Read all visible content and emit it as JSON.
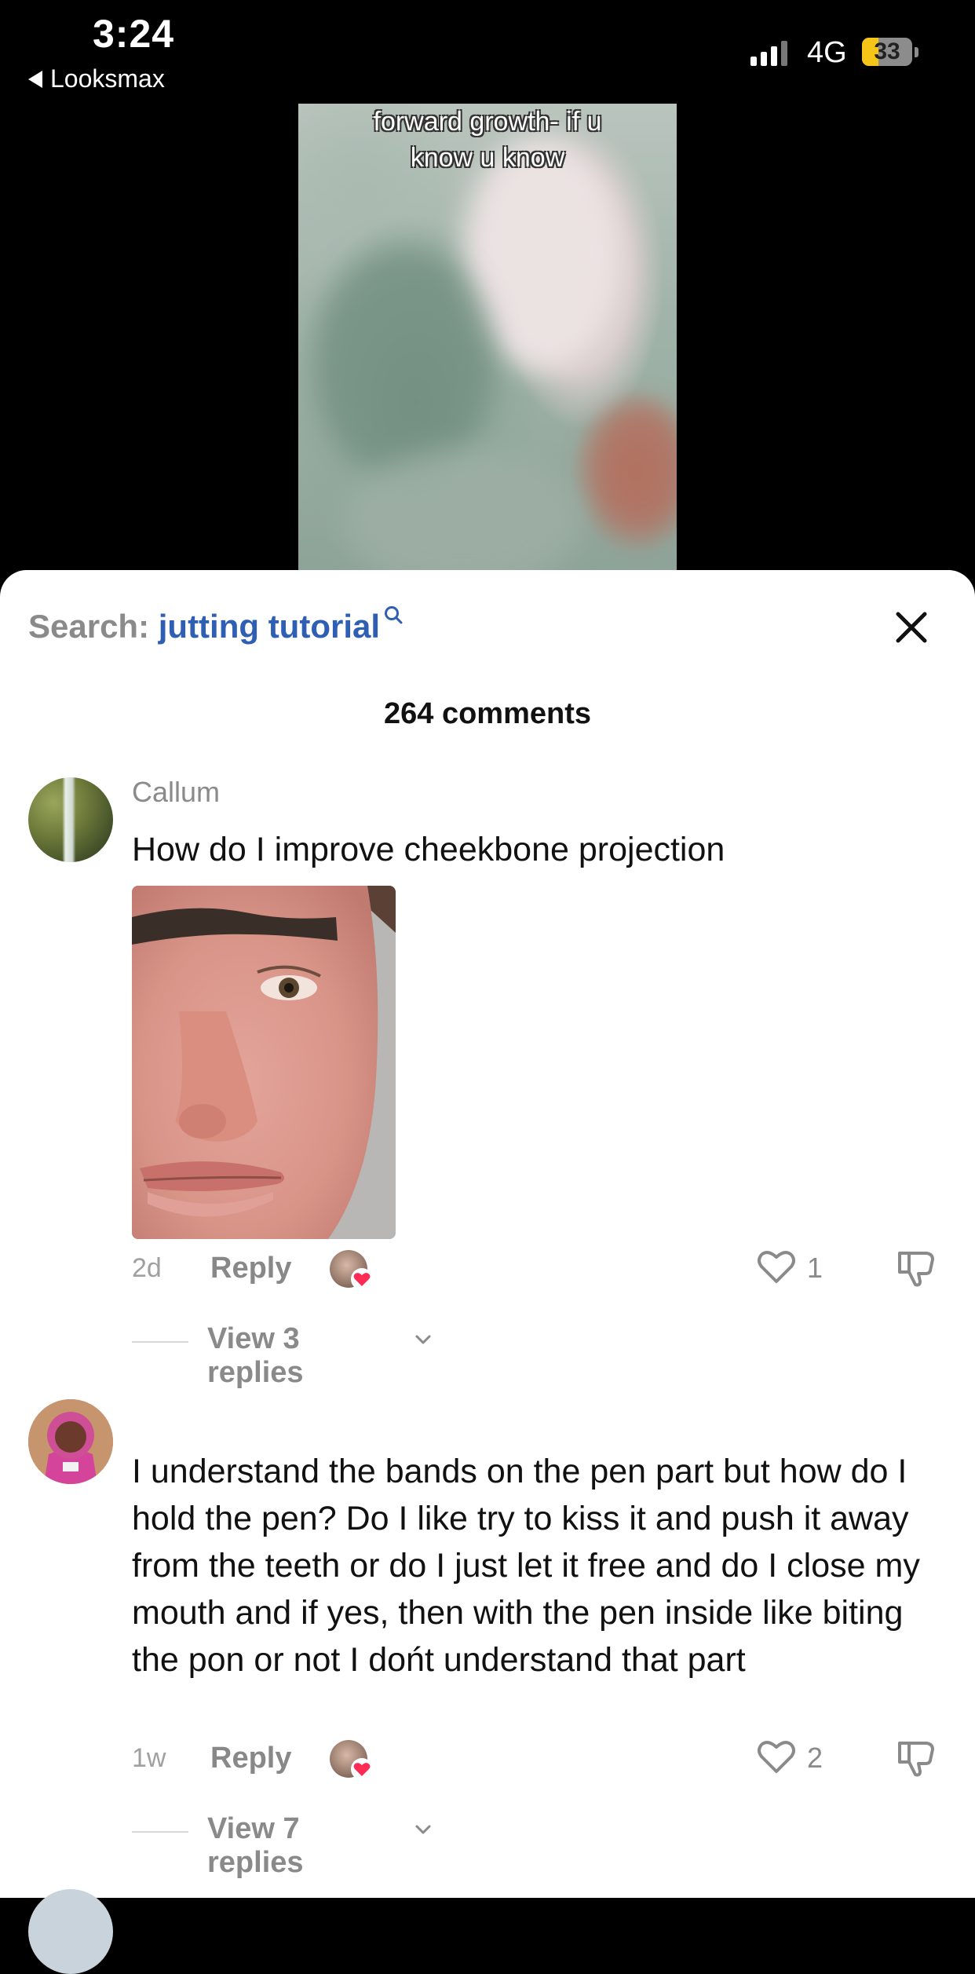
{
  "status_bar": {
    "time": "3:24",
    "back_label": "Looksmax",
    "network": "4G",
    "battery": "33",
    "battery_level": 0.33
  },
  "video": {
    "caption_line1": "forward growth- if u",
    "caption_line2": "know u know"
  },
  "sheet": {
    "search_label": "Search:",
    "search_term": "jutting tutorial",
    "comment_count": "264 comments"
  },
  "comments": [
    {
      "username": "Callum",
      "text": "How do I improve cheekbone projection",
      "time": "2d",
      "reply_label": "Reply",
      "likes": "1",
      "view_replies": "View 3 replies"
    },
    {
      "username": "",
      "text": "I understand the bands on the pen part but how do I hold the pen? Do I like try to kiss it and push it away from the teeth or do I just let it free and do I close my mouth and if yes, then with the pen inside like biting the pon or not I dońt understand that part",
      "time": "1w",
      "reply_label": "Reply",
      "likes": "2",
      "view_replies": "View 7 replies"
    }
  ],
  "colors": {
    "link_blue": "#2f5fb3",
    "heart_red": "#fe2c55",
    "battery_yellow": "#f5c518"
  }
}
